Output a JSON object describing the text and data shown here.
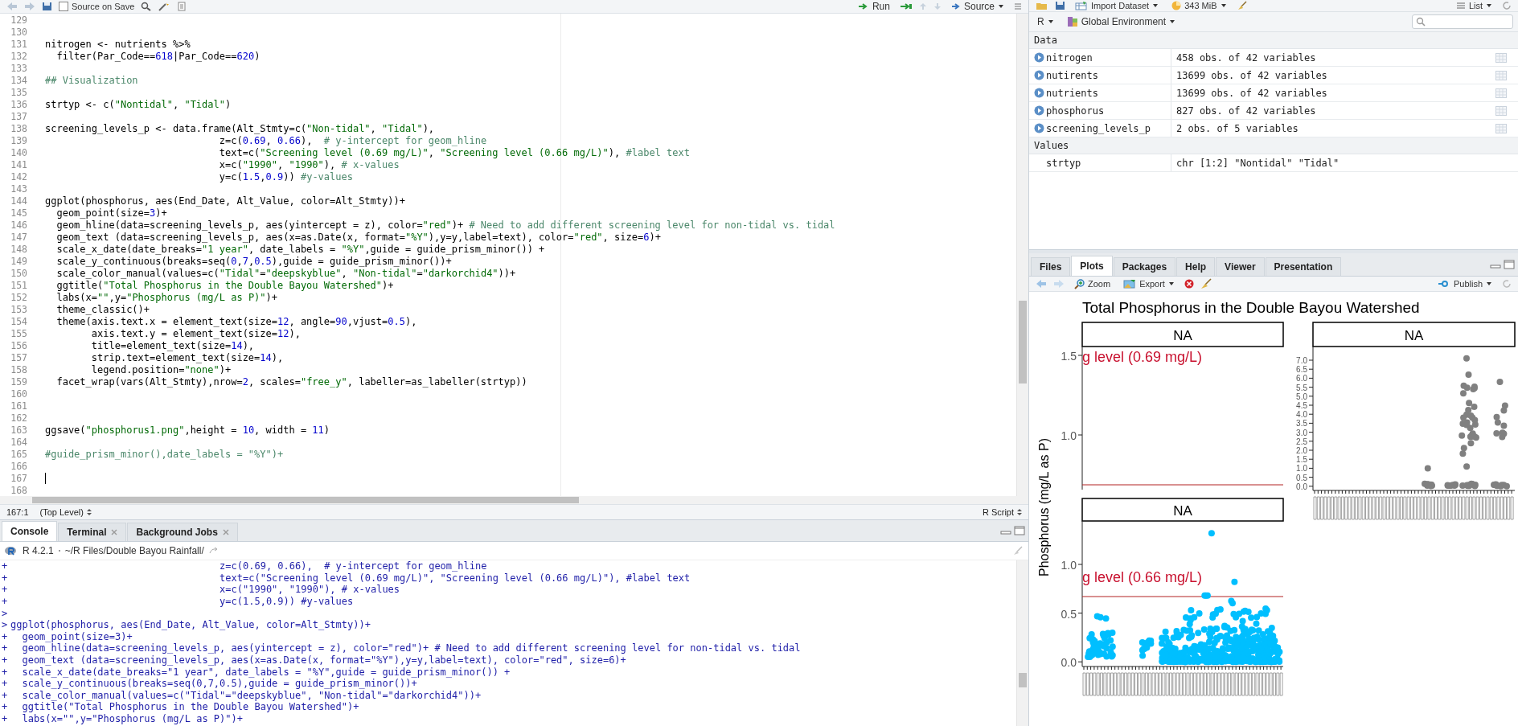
{
  "editor": {
    "toolbar": {
      "source_on_save": {
        "label": "Source on Save",
        "checked": false
      },
      "run": "Run",
      "source": "Source"
    },
    "lines": [
      {
        "number": "129",
        "cursor": false
      },
      {
        "number": "130",
        "cursor": false
      },
      {
        "number": "131",
        "code": "nitrogen <- nutrients %>%",
        "cursor": false
      },
      {
        "number": "132",
        "code": "  filter(Par_Code==618|Par_Code==620)",
        "cursor": false
      },
      {
        "number": "133",
        "cursor": false
      },
      {
        "number": "134",
        "code": "## Visualization",
        "cursor": false
      },
      {
        "number": "135",
        "cursor": false
      },
      {
        "number": "136",
        "code": "strtyp <- c(\"Nontidal\", \"Tidal\")",
        "cursor": false
      },
      {
        "number": "137",
        "cursor": false
      },
      {
        "number": "138",
        "code": "screening_levels_p <- data.frame(Alt_Stmty=c(\"Non-tidal\", \"Tidal\"),",
        "cursor": false
      },
      {
        "number": "139",
        "code": "                              z=c(0.69, 0.66),  # y-intercept for geom_hline",
        "cursor": false
      },
      {
        "number": "140",
        "code": "                              text=c(\"Screening level (0.69 mg/L)\", \"Screening level (0.66 mg/L)\"), #label text",
        "cursor": false
      },
      {
        "number": "141",
        "code": "                              x=c(\"1990\", \"1990\"), # x-values",
        "cursor": false
      },
      {
        "number": "142",
        "code": "                              y=c(1.5,0.9)) #y-values",
        "cursor": false
      },
      {
        "number": "143",
        "cursor": false
      },
      {
        "number": "144",
        "code": "ggplot(phosphorus, aes(End_Date, Alt_Value, color=Alt_Stmty))+",
        "cursor": false
      },
      {
        "number": "145",
        "code": "  geom_point(size=3)+",
        "cursor": false
      },
      {
        "number": "146",
        "code": "  geom_hline(data=screening_levels_p, aes(yintercept = z), color=\"red\")+ # Need to add different screening level for non-tidal vs. tidal",
        "cursor": false
      },
      {
        "number": "147",
        "code": "  geom_text (data=screening_levels_p, aes(x=as.Date(x, format=\"%Y\"),y=y,label=text), color=\"red\", size=6)+",
        "cursor": false
      },
      {
        "number": "148",
        "code": "  scale_x_date(date_breaks=\"1 year\", date_labels = \"%Y\",guide = guide_prism_minor()) +",
        "cursor": false
      },
      {
        "number": "149",
        "code": "  scale_y_continuous(breaks=seq(0,7,0.5),guide = guide_prism_minor())+",
        "cursor": false
      },
      {
        "number": "150",
        "code": "  scale_color_manual(values=c(\"Tidal\"=\"deepskyblue\", \"Non-tidal\"=\"darkorchid4\"))+",
        "cursor": false
      },
      {
        "number": "151",
        "code": "  ggtitle(\"Total Phosphorus in the Double Bayou Watershed\")+",
        "cursor": false
      },
      {
        "number": "152",
        "code": "  labs(x=\"\",y=\"Phosphorus (mg/L as P)\")+",
        "cursor": false
      },
      {
        "number": "153",
        "code": "  theme_classic()+",
        "cursor": false
      },
      {
        "number": "154",
        "code": "  theme(axis.text.x = element_text(size=12, angle=90,vjust=0.5),",
        "cursor": false
      },
      {
        "number": "155",
        "code": "        axis.text.y = element_text(size=12),",
        "cursor": false
      },
      {
        "number": "156",
        "code": "        title=element_text(size=14),",
        "cursor": false
      },
      {
        "number": "157",
        "code": "        strip.text=element_text(size=14),",
        "cursor": false
      },
      {
        "number": "158",
        "code": "        legend.position=\"none\")+",
        "cursor": false
      },
      {
        "number": "159",
        "code": "  facet_wrap(vars(Alt_Stmty),nrow=2, scales=\"free_y\", labeller=as_labeller(strtyp))",
        "cursor": false
      },
      {
        "number": "160",
        "cursor": false
      },
      {
        "number": "161",
        "cursor": false
      },
      {
        "number": "162",
        "cursor": false
      },
      {
        "number": "163",
        "code": "ggsave(\"phosphorus1.png\",height = 10, width = 11)",
        "cursor": false
      },
      {
        "number": "164",
        "cursor": false
      },
      {
        "number": "165",
        "code": "#guide_prism_minor(),date_labels = \"%Y\")+",
        "cursor": false
      },
      {
        "number": "166",
        "cursor": false
      },
      {
        "number": "167",
        "cursor": true
      },
      {
        "number": "168",
        "cursor": false
      }
    ],
    "status_bar": {
      "position": "167:1",
      "scope": "(Top Level)",
      "file_type": "R Script"
    }
  },
  "console": {
    "tabs": [
      {
        "label": "Console",
        "selected": true,
        "closable": false
      },
      {
        "label": "Terminal",
        "selected": false,
        "closable": true
      },
      {
        "label": "Background Jobs",
        "selected": false,
        "closable": true
      }
    ],
    "version": "R 4.2.1",
    "path": "~/R Files/Double Bayou Rainfall/",
    "lines": [
      {
        "prompt": "+",
        "code": "                                    z=c(0.69, 0.66),  # y-intercept for geom_hline"
      },
      {
        "prompt": "+",
        "code": "                                    text=c(\"Screening level (0.69 mg/L)\", \"Screening level (0.66 mg/L)\"), #label text"
      },
      {
        "prompt": "+",
        "code": "                                    x=c(\"1990\", \"1990\"), # x-values"
      },
      {
        "prompt": "+",
        "code": "                                    y=c(1.5,0.9)) #y-values"
      },
      {
        "prompt": ">"
      },
      {
        "prompt": ">",
        "code": "ggplot(phosphorus, aes(End_Date, Alt_Value, color=Alt_Stmty))+"
      },
      {
        "prompt": "+",
        "code": "  geom_point(size=3)+"
      },
      {
        "prompt": "+",
        "code": "  geom_hline(data=screening_levels_p, aes(yintercept = z), color=\"red\")+ # Need to add different screening level for non-tidal vs. tidal"
      },
      {
        "prompt": "+",
        "code": "  geom_text (data=screening_levels_p, aes(x=as.Date(x, format=\"%Y\"),y=y,label=text), color=\"red\", size=6)+"
      },
      {
        "prompt": "+",
        "code": "  scale_x_date(date_breaks=\"1 year\", date_labels = \"%Y\",guide = guide_prism_minor()) +"
      },
      {
        "prompt": "+",
        "code": "  scale_y_continuous(breaks=seq(0,7,0.5),guide = guide_prism_minor())+"
      },
      {
        "prompt": "+",
        "code": "  scale_color_manual(values=c(\"Tidal\"=\"deepskyblue\", \"Non-tidal\"=\"darkorchid4\"))+"
      },
      {
        "prompt": "+",
        "code": "  ggtitle(\"Total Phosphorus in the Double Bayou Watershed\")+"
      },
      {
        "prompt": "+",
        "code": "  labs(x=\"\",y=\"Phosphorus (mg/L as P)\")+"
      }
    ]
  },
  "environment": {
    "toolbar": {
      "import": "Import Dataset",
      "memory": "343 MiB",
      "view": "List"
    },
    "language": "R",
    "scope": "Global Environment",
    "sections": [
      {
        "title": "Data",
        "items": [
          {
            "name": "nitrogen",
            "value": "458 obs. of 42 variables",
            "kind": "data"
          },
          {
            "name": "nutirents",
            "value": "13699 obs. of 42 variables",
            "kind": "data"
          },
          {
            "name": "nutrients",
            "value": "13699 obs. of 42 variables",
            "kind": "data"
          },
          {
            "name": "phosphorus",
            "value": "827 obs. of 42 variables",
            "kind": "data"
          },
          {
            "name": "screening_levels_p",
            "value": "2 obs. of 5 variables",
            "kind": "data"
          }
        ]
      },
      {
        "title": "Values",
        "items": [
          {
            "name": "strtyp",
            "value": "chr [1:2] \"Nontidal\" \"Tidal\"",
            "kind": "value"
          }
        ]
      }
    ]
  },
  "plots_pane": {
    "tabs": [
      {
        "label": "Files",
        "selected": false
      },
      {
        "label": "Plots",
        "selected": true
      },
      {
        "label": "Packages",
        "selected": false
      },
      {
        "label": "Help",
        "selected": false
      },
      {
        "label": "Viewer",
        "selected": false
      },
      {
        "label": "Presentation",
        "selected": false
      }
    ],
    "toolbar": {
      "zoom": "Zoom",
      "export": "Export",
      "publish": "Publish"
    },
    "plot": {
      "title": "Total Phosphorus in the Double Bayou Watershed",
      "y_label": "Phosphorus (mg/L as P)",
      "panels": [
        {
          "strip": "NA",
          "annotation": "g level (0.69 mg/L)",
          "yticks": [
            "1.5",
            "1.0"
          ]
        },
        {
          "strip": "NA",
          "color": "#808080",
          "yticks": [
            "7.0",
            "6.5",
            "6.0",
            "5.5",
            "5.0",
            "4.5",
            "4.0",
            "3.5",
            "3.0",
            "2.5",
            "2.0",
            "1.5",
            "1.0",
            "0.5",
            "0.0"
          ]
        },
        {
          "strip": "NA",
          "annotation": "g level (0.66 mg/L)",
          "color": "#00bfff",
          "yticks": [
            "1.0",
            "0.5",
            "0.0"
          ]
        }
      ]
    }
  }
}
